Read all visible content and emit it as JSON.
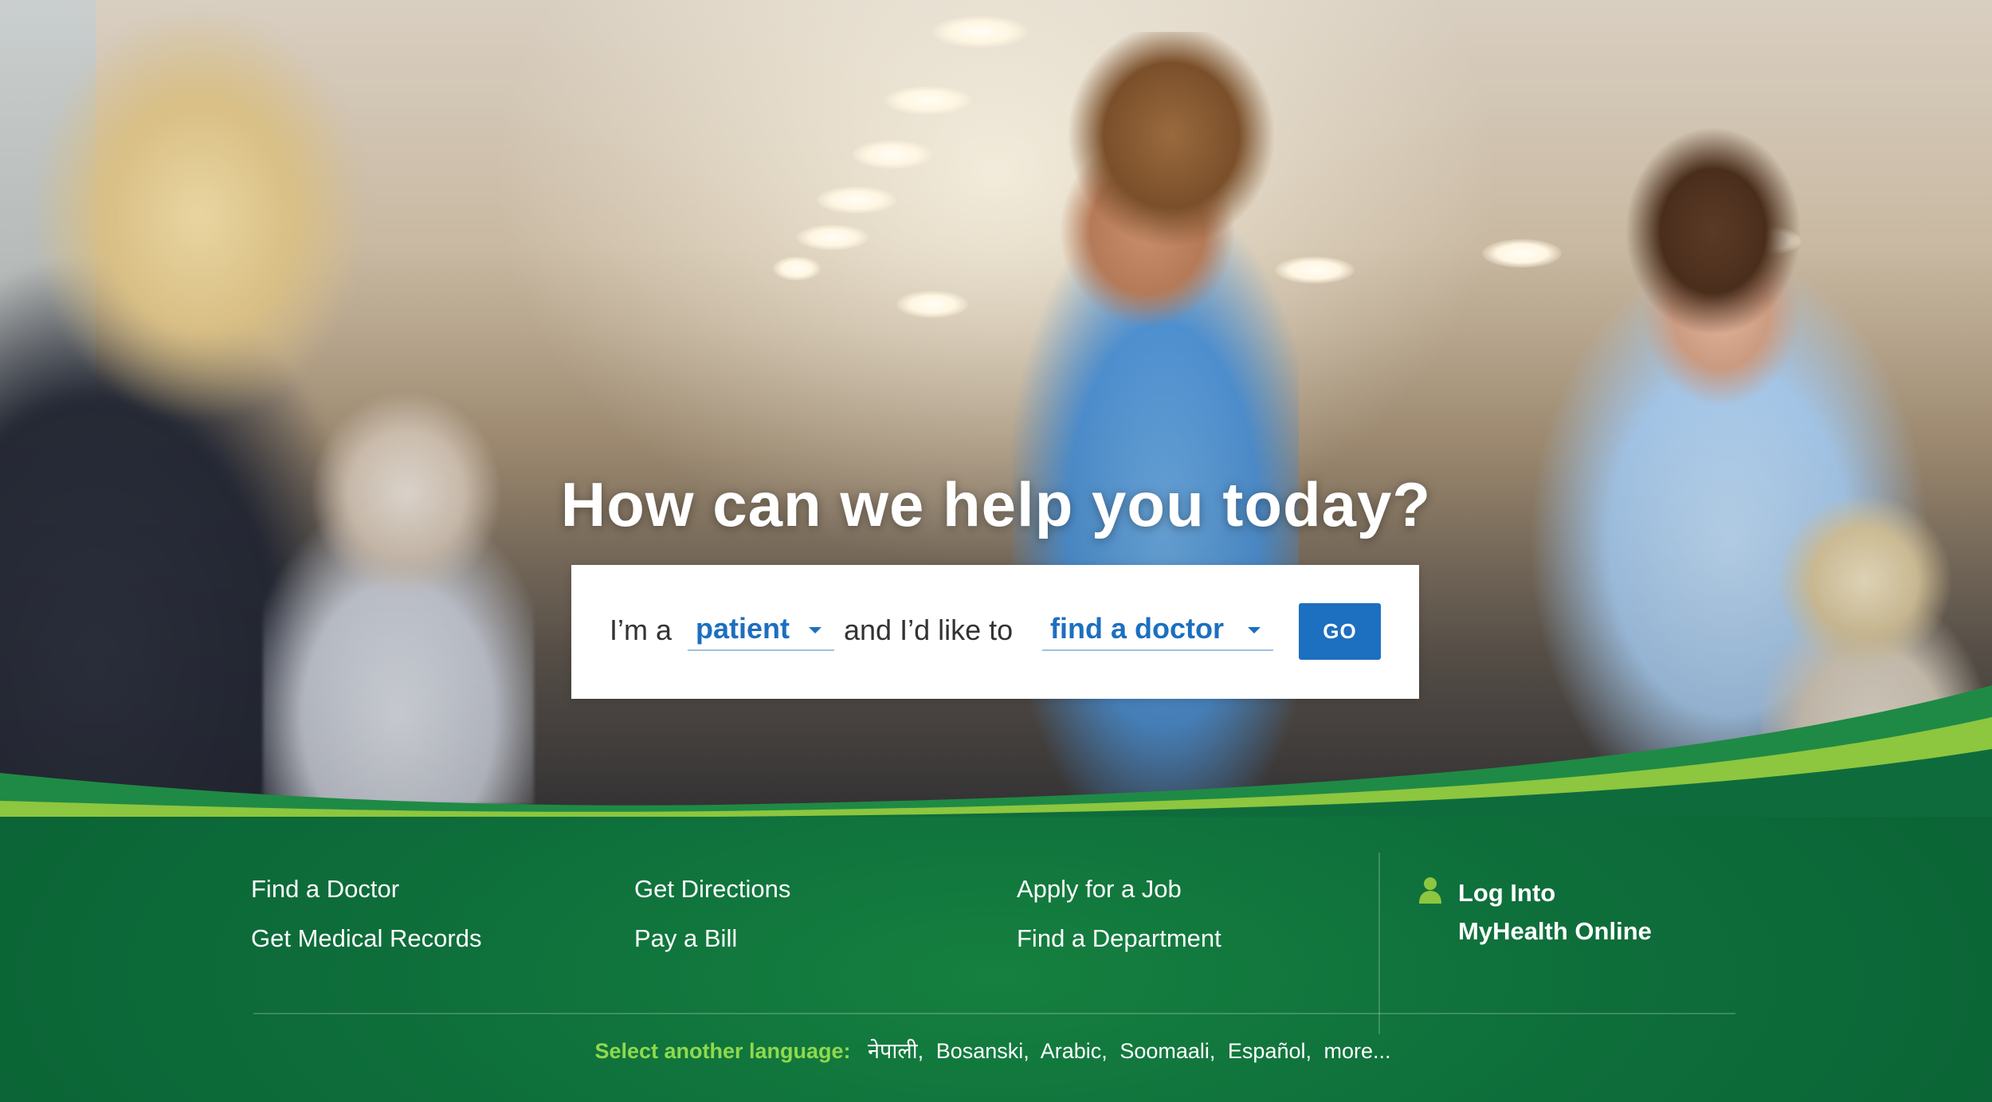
{
  "hero": {
    "title": "How can we help you today?"
  },
  "search": {
    "prefix": "I’m a",
    "role_value": "patient",
    "middle": "and I’d like to",
    "action_value": "find a doctor",
    "go_label": "GO"
  },
  "quick_links": [
    {
      "label": "Find a Doctor"
    },
    {
      "label": "Get Medical Records"
    },
    {
      "label": "Get Directions"
    },
    {
      "label": "Pay a Bill"
    },
    {
      "label": "Apply for a Job"
    },
    {
      "label": "Find a Department"
    }
  ],
  "login": {
    "line1": "Log Into",
    "line2": "MyHealth Online"
  },
  "languages": {
    "label": "Select another language:",
    "items": [
      "नेपाली,",
      "Bosanski,",
      "Arabic,",
      "Soomaali,",
      "Español,",
      "more..."
    ]
  },
  "colors": {
    "footer_green": "#0e6c3c",
    "wave_light_green": "#8dc63f",
    "link_blue": "#1d6fbf",
    "language_label_green": "#8fd94d"
  },
  "icons": {
    "login": "user-icon"
  }
}
